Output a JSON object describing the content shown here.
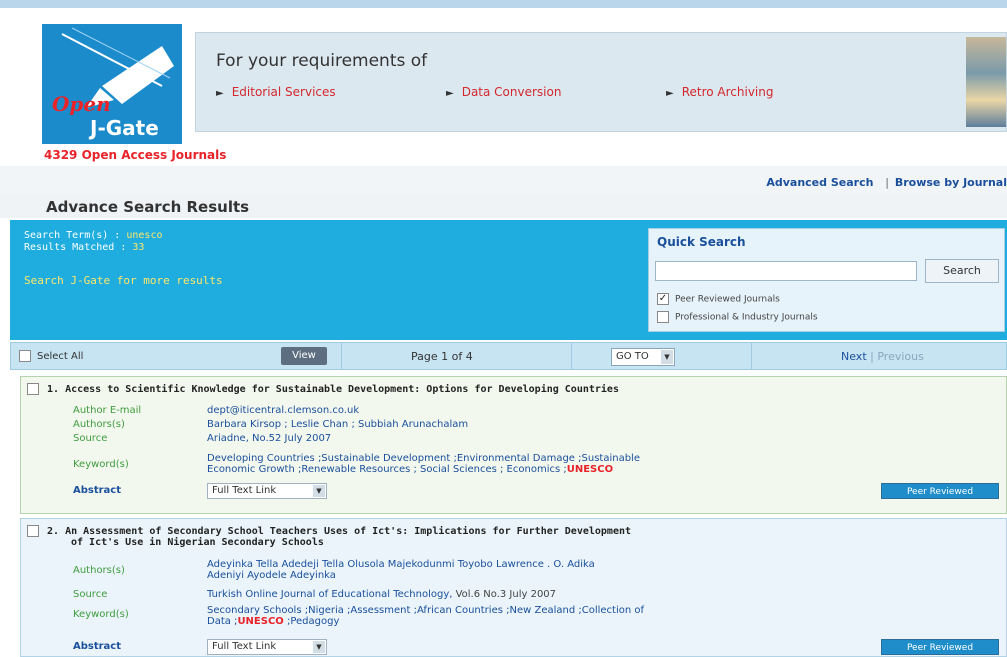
{
  "header": {
    "logo_open": "Open",
    "logo_jgate": "J-Gate",
    "open_access_count": "4329 Open Access Journals"
  },
  "banner": {
    "title": "For your requirements of",
    "links": [
      "Editorial Services",
      "Data Conversion",
      "Retro Archiving"
    ]
  },
  "nav": {
    "advanced_search": "Advanced Search",
    "separator": "|",
    "browse_by_journal": "Browse by Journal"
  },
  "page_title": "Advance Search Results",
  "summary": {
    "search_terms_label": "Search Term(s) :",
    "search_terms_value": "unesco",
    "results_label": "Results Matched :",
    "results_value": "33",
    "more_results": "Search J-Gate for more results"
  },
  "quick_search": {
    "title": "Quick Search",
    "input_value": "",
    "button": "Search",
    "options": [
      {
        "label": "Peer Reviewed Journals",
        "checked": true
      },
      {
        "label": "Professional & Industry Journals",
        "checked": false
      }
    ]
  },
  "pager": {
    "select_all": "Select All",
    "view": "View",
    "page_info": "Page 1 of 4",
    "goto": "GO TO",
    "next": "Next",
    "separator": "|",
    "previous": "Previous"
  },
  "records": [
    {
      "number": "1.",
      "title": "Access to Scientific Knowledge for Sustainable Development: Options for Developing Countries",
      "fields": [
        {
          "label": "Author E-mail",
          "value": "dept@iticentral.clemson.co.uk"
        },
        {
          "label": "Authors(s)",
          "value": "Barbara Kirsop ; Leslie Chan ; Subbiah Arunachalam"
        },
        {
          "label": "Source",
          "value": "Ariadne, No.52 July 2007"
        },
        {
          "label": "Keyword(s)",
          "value": "Developing Countries ;Sustainable Development ;Environmental Damage ;Sustainable",
          "value2": "Economic Growth ;Renewable Resources ; Social Sciences ; Economics ;",
          "highlight": "UNESCO"
        }
      ],
      "abstract_label": "Abstract",
      "full_text": "Full Text Link",
      "peer_reviewed": "Peer Reviewed"
    },
    {
      "number": "2.",
      "title": "An Assessment of Secondary School Teachers Uses of Ict's: Implications for Further Development",
      "title2": "of Ict's Use in Nigerian Secondary Schools",
      "fields": [
        {
          "label": "Authors(s)",
          "value": "Adeyinka Tella Adedeji Tella Olusola Majekodunmi Toyobo Lawrence . O. Adika",
          "value2": "Adeniyi Ayodele Adeyinka"
        },
        {
          "label": "Source",
          "value": "Turkish Online Journal of Educational Technology,",
          "plain": " Vol.6 No.3 July 2007"
        },
        {
          "label": "Keyword(s)",
          "value": "Secondary Schools ;Nigeria ;Assessment ;African Countries ;New Zealand ;Collection of",
          "value2_pre": "Data ;",
          "highlight": "UNESCO",
          "value2_post": " ;Pedagogy"
        }
      ],
      "abstract_label": "Abstract",
      "full_text": "Full Text Link",
      "peer_reviewed": "Peer Reviewed"
    }
  ],
  "colors": {
    "summary_bg": "#1eadde",
    "link_blue": "#1a4f9c",
    "label_green": "#3f9c3f",
    "highlight_red": "#e8232a"
  }
}
